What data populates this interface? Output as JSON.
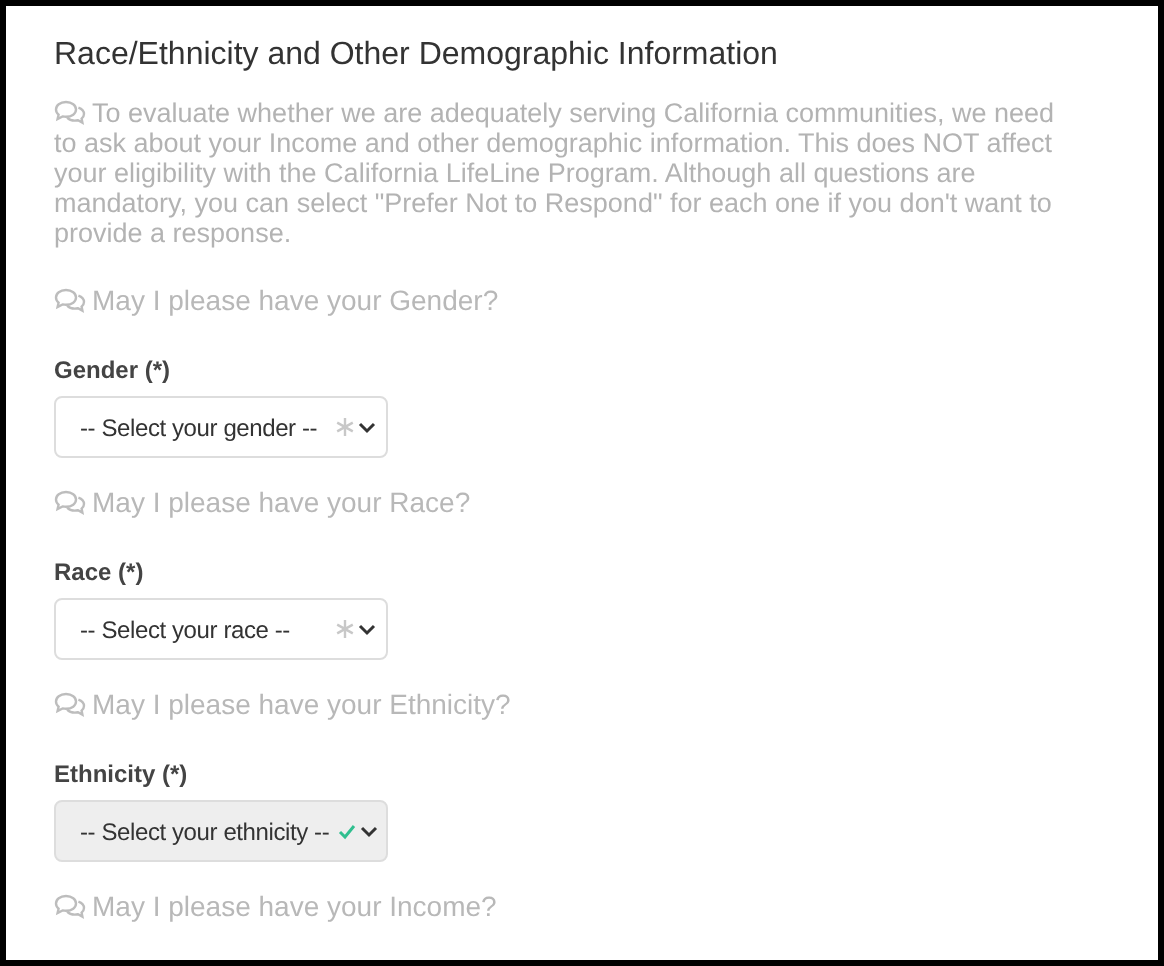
{
  "title": "Race/Ethnicity and Other Demographic Information",
  "intro": "To evaluate whether we are adequately serving California communities, we need to ask about your Income and other demographic information. This does NOT affect your eligibility with the California LifeLine Program. Although all questions are mandatory, you can select \"Prefer Not to Respond\" for each one if you don't want to provide a response.",
  "questions": [
    {
      "prompt": "May I please have your Gender?",
      "label": "Gender (*)",
      "select": {
        "value": "-- Select your gender --",
        "valid": false
      }
    },
    {
      "prompt": "May I please have your Race?",
      "label": "Race (*)",
      "select": {
        "value": "-- Select your race --",
        "valid": false
      }
    },
    {
      "prompt": "May I please have your Ethnicity?",
      "label": "Ethnicity (*)",
      "select": {
        "value": "-- Select your ethnicity --",
        "valid": true
      }
    },
    {
      "prompt": "May I please have your Income?"
    }
  ]
}
